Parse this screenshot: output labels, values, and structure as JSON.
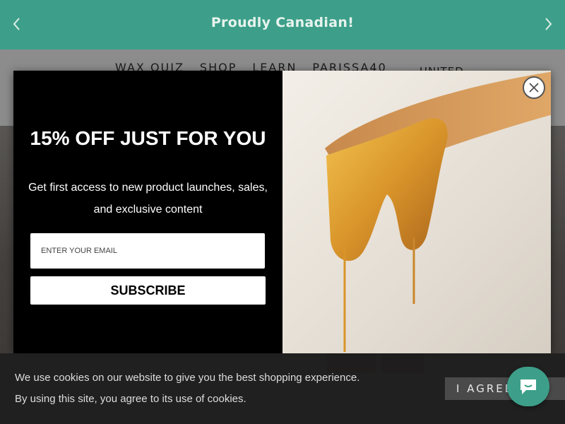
{
  "announcement": {
    "text": "Proudly Canadian!"
  },
  "nav": {
    "items": [
      "WAX QUIZ",
      "SHOP",
      "LEARN",
      "PARISSA40"
    ]
  },
  "region": {
    "label": "UNITED"
  },
  "popup": {
    "title": "15% OFF JUST FOR YOU",
    "subtitle": "Get first access to new product launches, sales, and exclusive content",
    "email_placeholder": "ENTER YOUR EMAIL",
    "subscribe_label": "SUBSCRIBE"
  },
  "cookie": {
    "line1": "We use cookies on our website to give you the best shopping experience.",
    "line2": "By using this site, you agree to its use of cookies.",
    "agree_label": "I AGREE"
  },
  "colors": {
    "brand_teal": "#3d9f89",
    "honey": "#d99a2b",
    "modal_bg": "#000000"
  },
  "icons": [
    "chevron-left-icon",
    "chevron-right-icon",
    "close-icon",
    "chat-icon"
  ]
}
